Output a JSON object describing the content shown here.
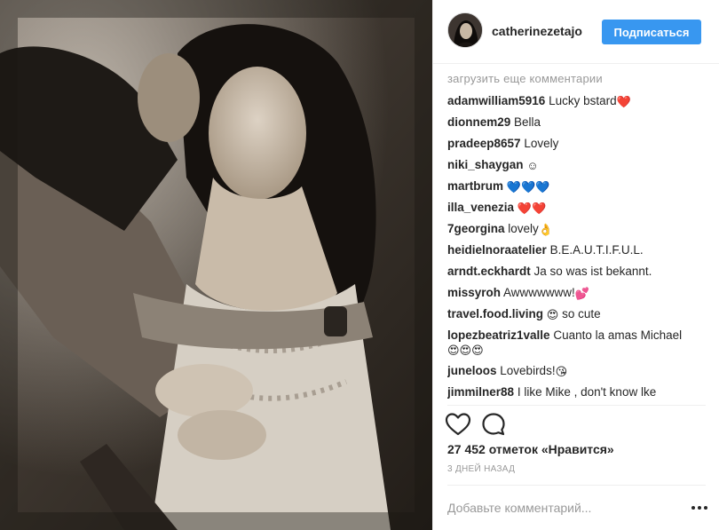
{
  "header": {
    "username": "catherinezetajo",
    "follow_label": "Подписаться"
  },
  "comments_section": {
    "load_more": "загрузить еще комментарии",
    "items": [
      {
        "user": "adamwilliam5916",
        "text": "Lucky bstard",
        "emoji": "❤️"
      },
      {
        "user": "dionnem29",
        "text": "Bella",
        "emoji": ""
      },
      {
        "user": "pradeep8657",
        "text": "Lovely",
        "emoji": ""
      },
      {
        "user": "niki_shaygan",
        "text": "",
        "emoji": "☺"
      },
      {
        "user": "martbrum",
        "text": "",
        "emoji": "💙💙💙"
      },
      {
        "user": "illa_venezia",
        "text": "",
        "emoji": "❤️❤️"
      },
      {
        "user": "7georgina",
        "text": "lovely",
        "emoji": "👌"
      },
      {
        "user": "heidielnoraatelier",
        "text": "B.E.A.U.T.I.F.U.L.",
        "emoji": ""
      },
      {
        "user": "arndt.eckhardt",
        "text": "Ja so was ist bekannt.",
        "emoji": ""
      },
      {
        "user": "missyroh",
        "text": "Awwwwwww!",
        "emoji": "💕"
      },
      {
        "user": "travel.food.living",
        "text": "so cute",
        "emoji": "😍",
        "emoji_first": true
      },
      {
        "user": "lopezbeatriz1valle",
        "text": "Cuanto la amas Michael",
        "emoji": "😍😍😍",
        "wrap": true
      },
      {
        "user": "juneloos",
        "text": "Lovebirds!",
        "emoji": "😘"
      },
      {
        "user": "jimmilner88",
        "text": "I like Mike , don't know lke",
        "emoji": ""
      }
    ]
  },
  "actions": {
    "like_icon": "heart-outline",
    "comment_icon": "speech-bubble-outline"
  },
  "likes_text": "27 452 отметок «Нравится»",
  "timestamp": "3 дней назад",
  "add_comment": {
    "placeholder": "Добавьте комментарий..."
  },
  "more_icon": "ellipsis",
  "colors": {
    "accent": "#3897f0",
    "text": "#262626",
    "muted": "#999999",
    "border": "#efefef"
  }
}
